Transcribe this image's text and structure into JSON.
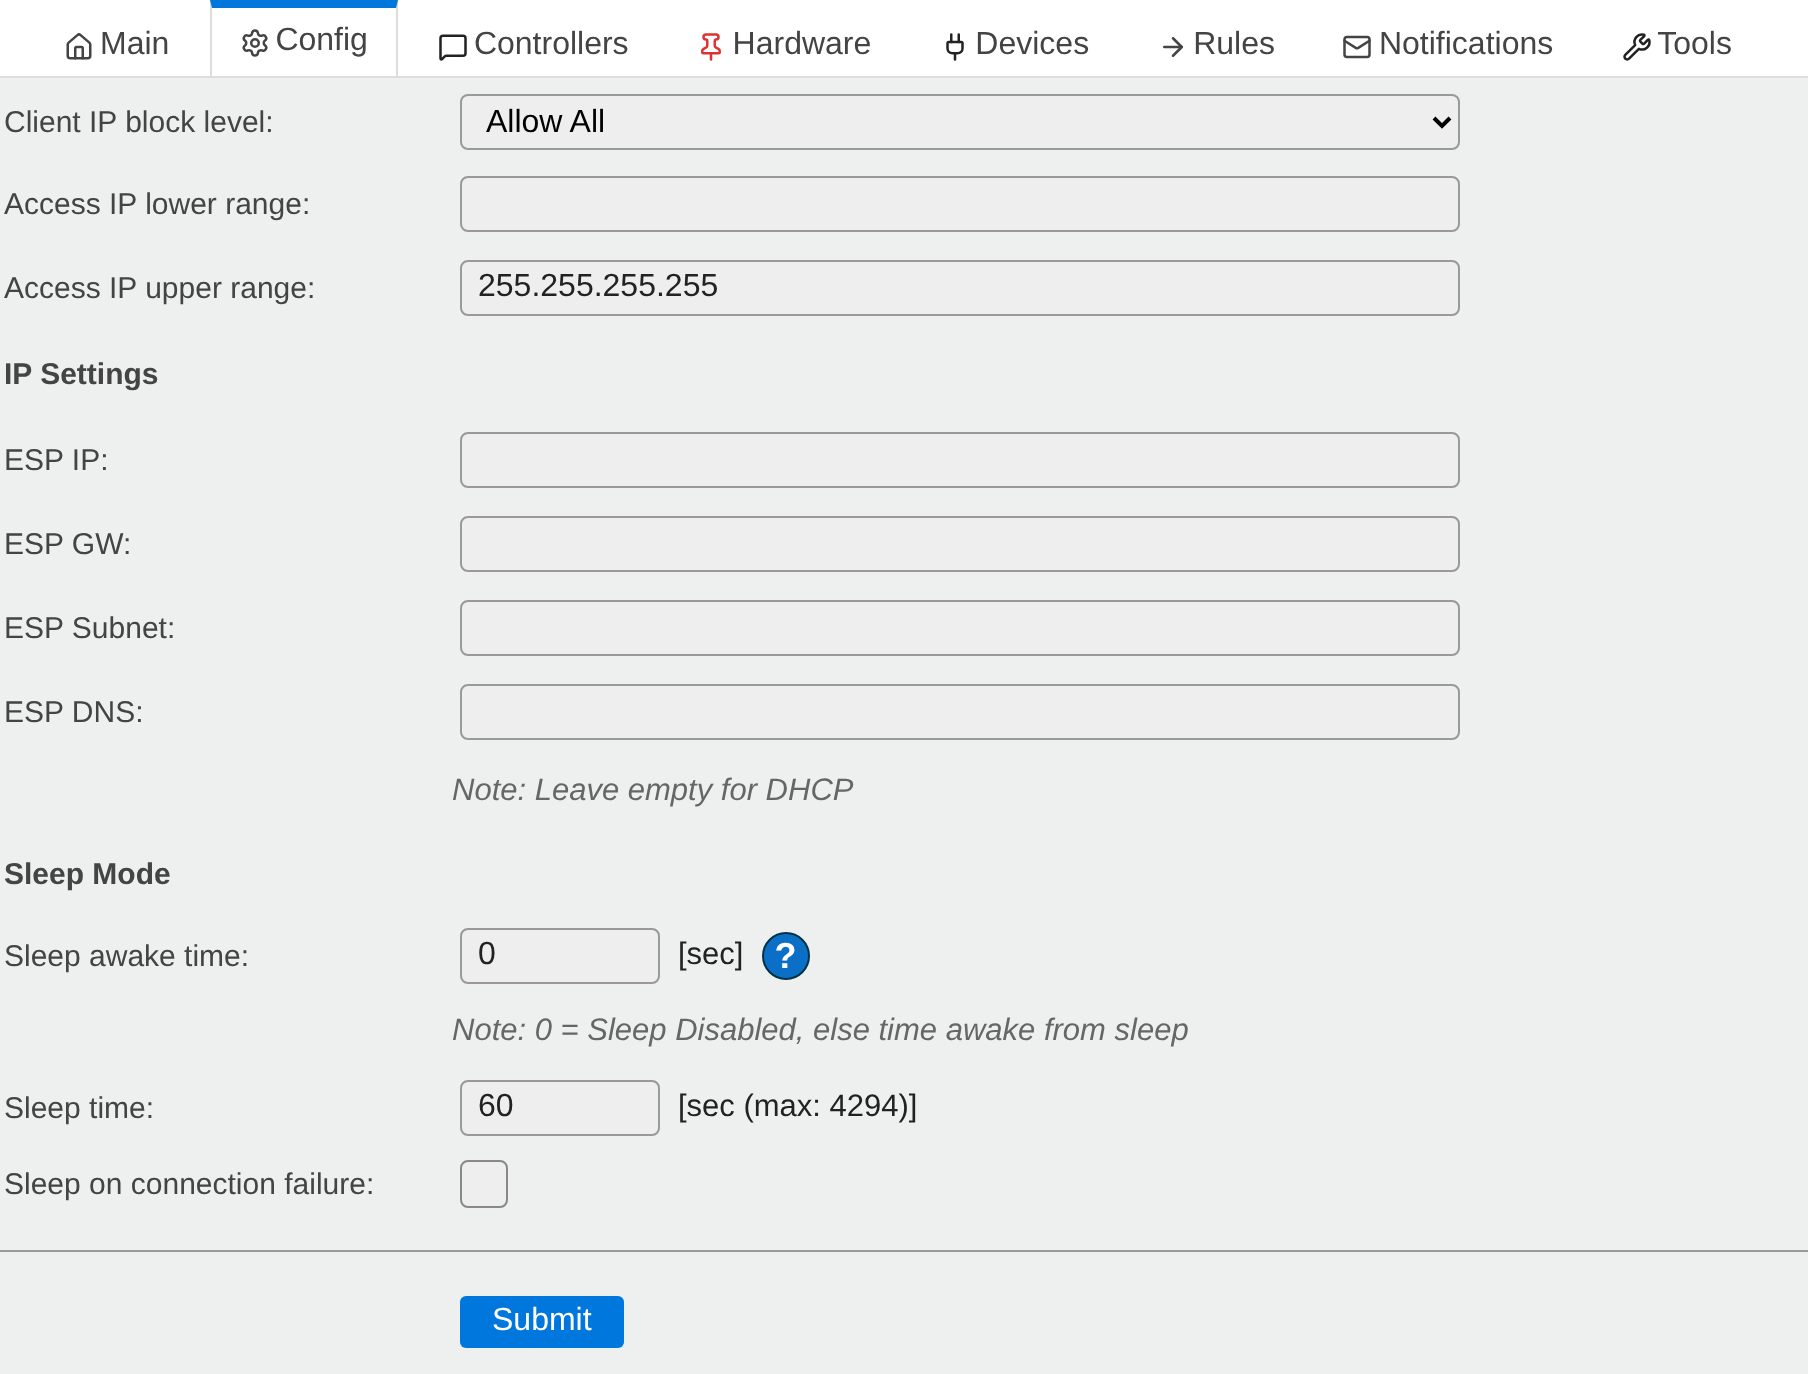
{
  "tabs": [
    {
      "label": "Main",
      "selected": false
    },
    {
      "label": "Config",
      "selected": true
    },
    {
      "label": "Controllers",
      "selected": false
    },
    {
      "label": "Hardware",
      "selected": false
    },
    {
      "label": "Devices",
      "selected": false
    },
    {
      "label": "Rules",
      "selected": false
    },
    {
      "label": "Notifications",
      "selected": false
    },
    {
      "label": "Tools",
      "selected": false
    }
  ],
  "rows": [
    {
      "kind": "select",
      "label": "Client IP block level:",
      "value": "Allow All"
    },
    {
      "kind": "text",
      "label": "Access IP lower range:"
    },
    {
      "kind": "text",
      "label": "Access IP upper range:",
      "value": "255.255.255.255"
    },
    {
      "kind": "heading",
      "label": "IP Settings"
    },
    {
      "kind": "text",
      "label": "ESP IP:"
    },
    {
      "kind": "text",
      "label": "ESP GW:"
    },
    {
      "kind": "text",
      "label": "ESP Subnet:"
    },
    {
      "kind": "text",
      "label": "ESP DNS:"
    },
    {
      "kind": "note",
      "label": "Note: Leave empty for DHCP"
    },
    {
      "kind": "heading",
      "label": "Sleep Mode"
    },
    {
      "kind": "number",
      "label": "Sleep awake time:",
      "value": "0",
      "suffix": "[sec]",
      "help": "?"
    },
    {
      "kind": "note",
      "label": "Note: 0 = Sleep Disabled, else time awake from sleep"
    },
    {
      "kind": "number",
      "label": "Sleep time:",
      "value": "60",
      "suffix": "[sec (max: 4294)]"
    },
    {
      "kind": "checkbox",
      "label": "Sleep on connection failure:",
      "checked": false
    }
  ],
  "submit": "Submit"
}
